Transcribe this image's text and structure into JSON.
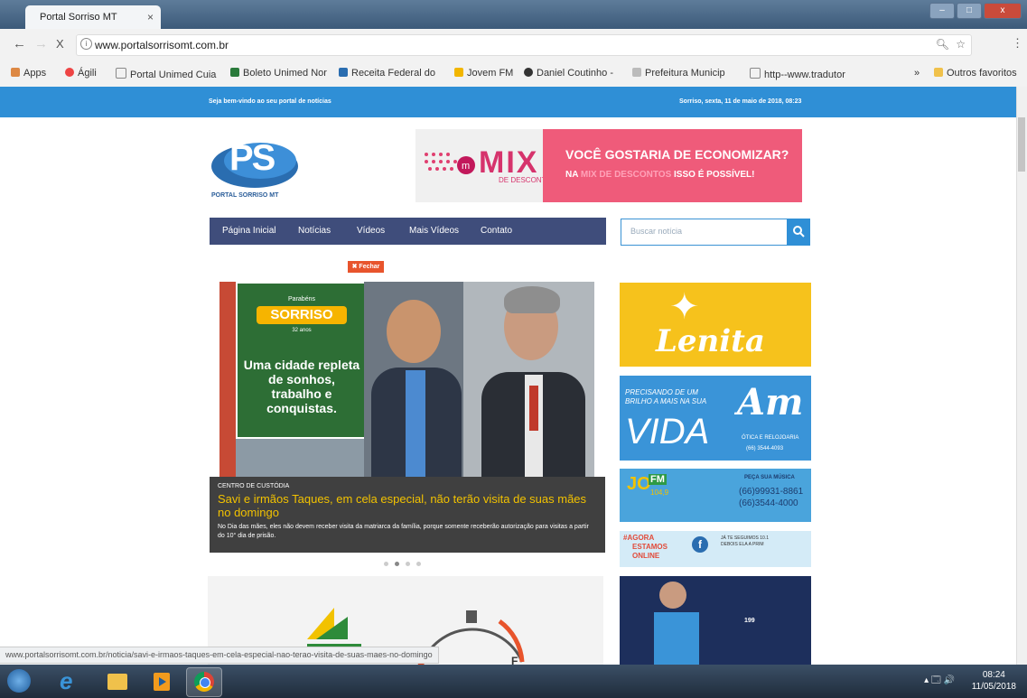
{
  "browser": {
    "tab_title": "Portal Sorriso MT",
    "tab_close": "×",
    "url": "www.portalsorrisomt.com.br",
    "stop_glyph": "X",
    "back_glyph": "←",
    "bookmarks": [
      {
        "label": "Apps"
      },
      {
        "label": "Ágili"
      },
      {
        "label": "Portal Unimed Cuia"
      },
      {
        "label": "Boleto Unimed Nor"
      },
      {
        "label": "Receita Federal do"
      },
      {
        "label": "Jovem FM"
      },
      {
        "label": "Daniel Coutinho -"
      },
      {
        "label": "Prefeitura Municip"
      },
      {
        "label": "http--www.tradutor"
      }
    ],
    "more_bookmarks": "»",
    "other_favorites": "Outros favoritos",
    "status_url": "www.portalsorrisomt.com.br/noticia/savi-e-irmaos-taques-em-cela-especial-nao-terao-visita-de-suas-maes-no-domingo"
  },
  "site": {
    "welcome": "Seja bem-vindo ao seu portal de notícias",
    "dateline": "Sorriso, sexta, 11 de maio de 2018, 08:23",
    "logo_text": "PS",
    "logo_caption": "PORTAL SORRISO MT",
    "banner": {
      "brand": "MIX",
      "brand_sub": "DE DESCONTOS",
      "headline": "VOCÊ GOSTARIA DE ECONOMIZAR?",
      "line2_a": "NA",
      "line2_b": "MIX DE DESCONTOS",
      "line2_c": "ISSO É POSSÍVEL!"
    },
    "nav": [
      "Página Inicial",
      "Notícias",
      "Vídeos",
      "Mais Vídeos",
      "Contato"
    ],
    "search_placeholder": "Buscar notícia",
    "close_ad": "✖ Fechar",
    "slide_ad": {
      "parabens": "Parabéns",
      "city": "SORRISO",
      "anos": "32 anos",
      "slogan": "Uma cidade repleta de sonhos, trabalho e conquistas."
    },
    "headline": {
      "category": "CENTRO DE CUSTÓDIA",
      "title": "Savi e irmãos Taques, em cela especial, não terão visita de suas mães no domingo",
      "desc": "No Dia das mães, eles não devem receber visita da matriarca da família, porque somente receberão autorização para visitas a partir do 10° dia de prisão."
    },
    "slider_dots": 4,
    "slider_active": 1,
    "side_ads": {
      "lenita": "Lenita",
      "am_line1": "PRECISANDO DE UM",
      "am_line2": "BRILHO A MAIS NA SUA",
      "am_vida": "VIDA",
      "am_logo": "Am",
      "am_sub": "ÓTICA E RELOJOARIA",
      "am_phone": "(66) 3544-4093",
      "radio_title": "PEÇA SUA MÚSICA",
      "radio_phone1": "(66)99931-8861",
      "radio_phone2": "(66)3544-4000",
      "radio_jo": "JO",
      "radio_fm": "FM",
      "radio_freq": "104,9",
      "online_1": "#AGORA",
      "online_2": "ESTAMOS",
      "online_3": "ONLINE",
      "online_4": "JÁ TE SEGUIMOS 10.1",
      "online_5": "DEBOIS ELA A PRIM",
      "bottom_ad_phone": "199"
    }
  },
  "taskbar": {
    "time": "08:24",
    "date": "11/05/2018"
  }
}
